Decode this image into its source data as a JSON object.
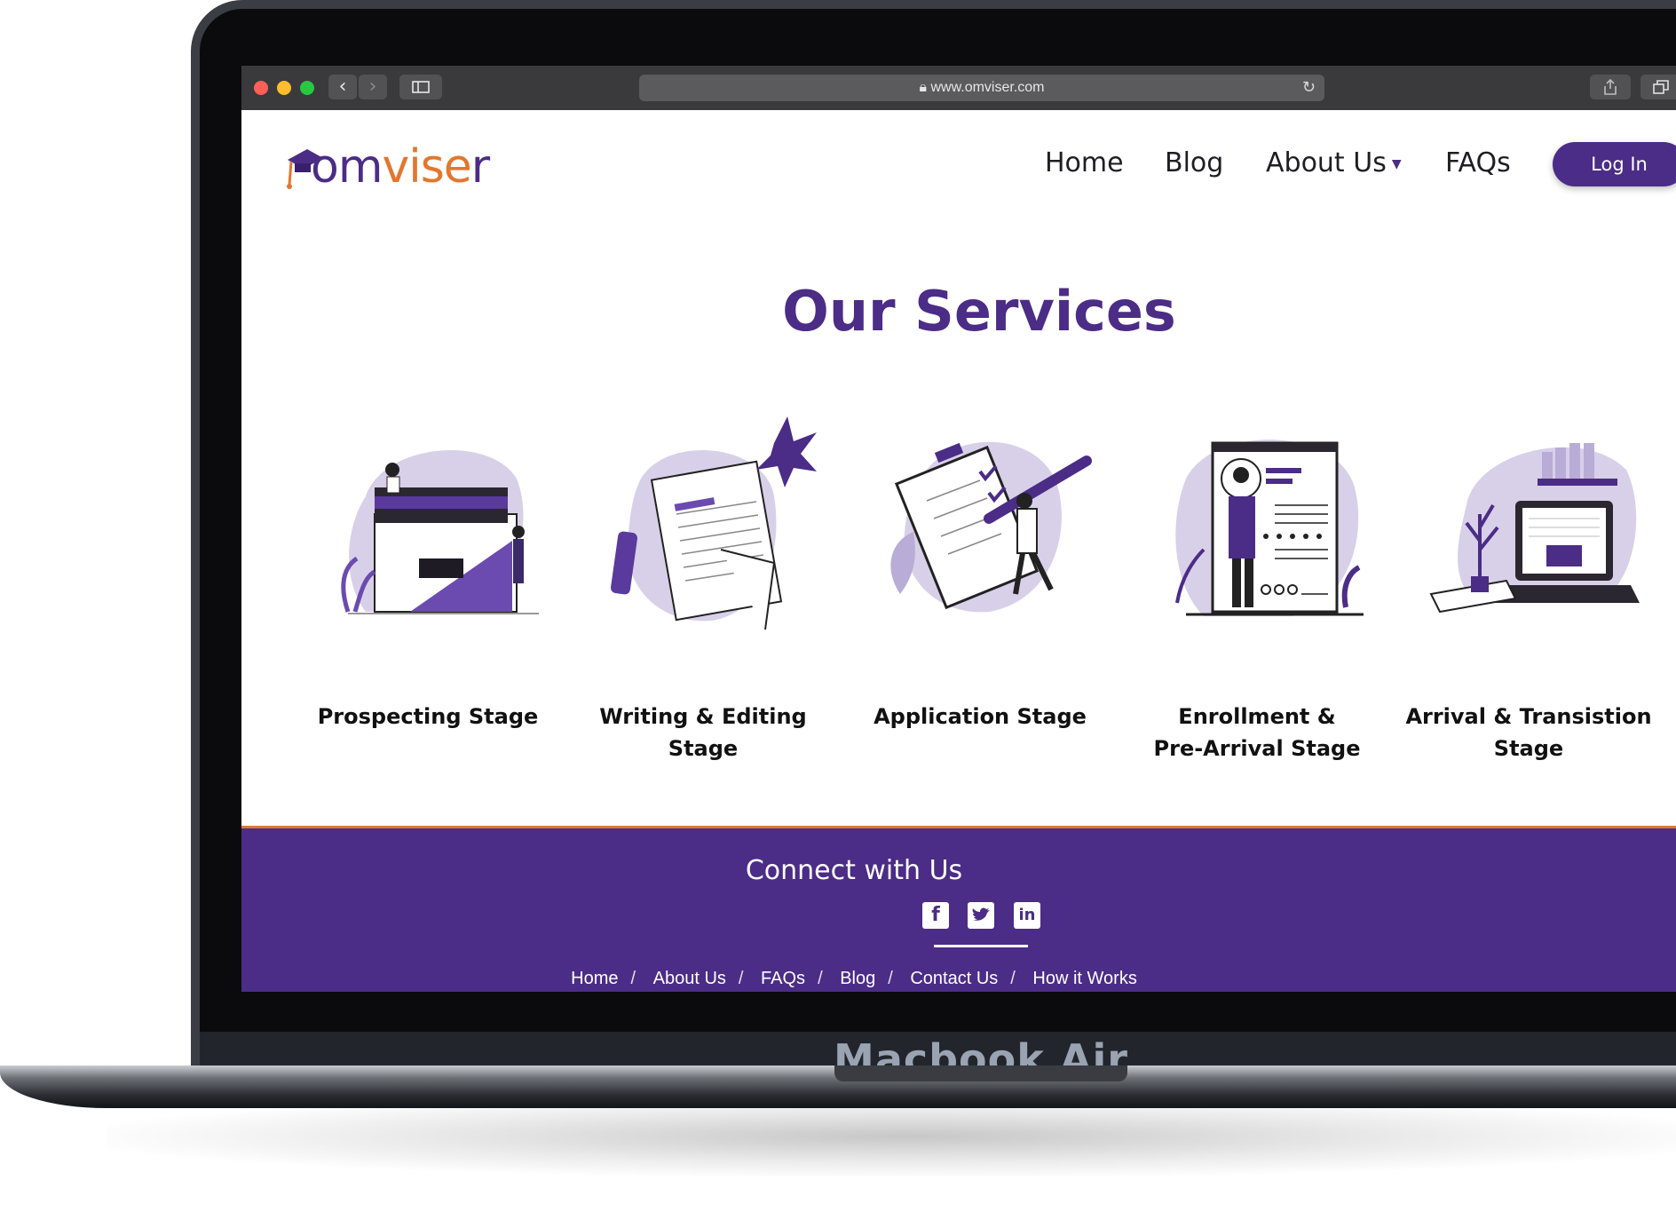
{
  "browser": {
    "url": "www.omviser.com",
    "lock_icon": "lock-icon",
    "back_icon": "chevron-left-icon",
    "forward_icon": "chevron-right-icon",
    "reload_icon": "reload-icon"
  },
  "logo": {
    "text": "omviser"
  },
  "nav": {
    "home": "Home",
    "blog": "Blog",
    "about": "About Us",
    "faqs": "FAQs",
    "login": "Log In"
  },
  "services": {
    "title": "Our Services",
    "items": [
      {
        "label": "Prospecting Stage"
      },
      {
        "label": "Writing & Editing Stage"
      },
      {
        "label": "Application Stage"
      },
      {
        "label": "Enrollment &",
        "label2": "Pre-Arrival Stage"
      },
      {
        "label": "Arrival & Transistion Stage"
      }
    ]
  },
  "footer": {
    "title": "Connect with Us",
    "links": [
      "Home",
      "About Us",
      "FAQs",
      "Blog",
      "Contact Us",
      "How it Works"
    ]
  },
  "device": {
    "label": "Macbook Air"
  },
  "colors": {
    "brand_purple": "#4b2c86",
    "accent_orange": "#e2772f",
    "light_purple": "#d8d0e8"
  }
}
